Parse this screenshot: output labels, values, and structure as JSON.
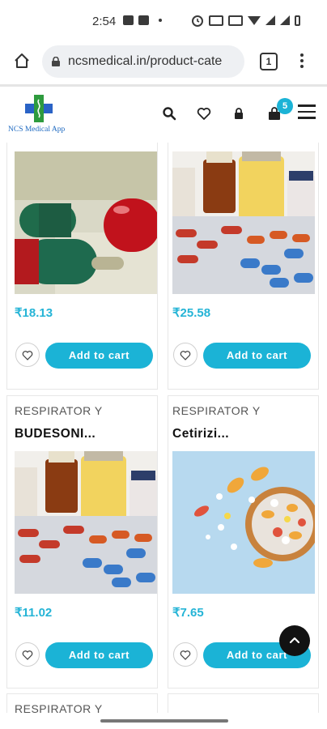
{
  "status_bar": {
    "time": "2:54",
    "icons": [
      "message-icon",
      "chat-icon",
      "dot-icon",
      "alarm-icon",
      "sim-box-icon",
      "sim-box-icon",
      "wifi-icon",
      "signal-icon",
      "signal-icon",
      "battery-icon"
    ]
  },
  "browser": {
    "url": "ncsmedical.in/product-cate",
    "tab_count": "1"
  },
  "site": {
    "logo_text": "NCS Medical App",
    "cart_count": "5",
    "colors": {
      "accent": "#1bb3d6",
      "price": "#25b4d6"
    }
  },
  "products": [
    {
      "category": "",
      "name": "",
      "price": "₹18.13",
      "image": "capsules-photo",
      "cart_label": "Add to cart"
    },
    {
      "category": "",
      "name": "",
      "price": "₹25.58",
      "image": "medicine-bottles-photo",
      "cart_label": "Add to cart"
    },
    {
      "category": "RESPIRATOR Y",
      "name": "BUDESONI...",
      "price": "₹11.02",
      "image": "medicine-bottles-photo",
      "cart_label": "Add to cart"
    },
    {
      "category": "RESPIRATOR Y",
      "name": "Cetirizi...",
      "price": "₹7.65",
      "image": "pill-bowl-photo",
      "cart_label": "Add to cart"
    },
    {
      "category": "RESPIRATOR Y",
      "name": "",
      "price": "",
      "image": "",
      "cart_label": ""
    },
    {
      "category": "",
      "name": "",
      "price": "",
      "image": "",
      "cart_label": ""
    }
  ]
}
